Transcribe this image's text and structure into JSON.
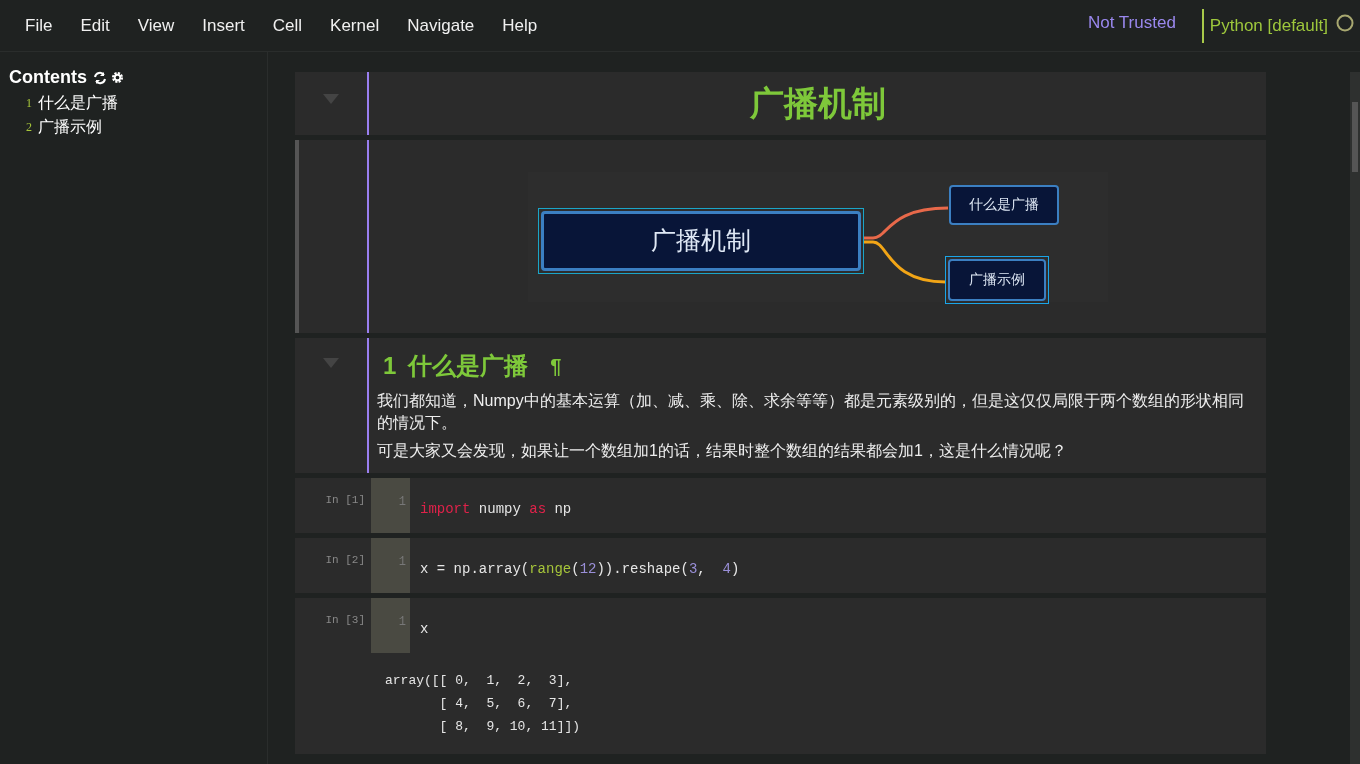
{
  "menu": [
    "File",
    "Edit",
    "View",
    "Insert",
    "Cell",
    "Kernel",
    "Navigate",
    "Help"
  ],
  "trust": "Not Trusted",
  "kernel": "Python [default]",
  "toc": {
    "title": "Contents",
    "items": [
      {
        "number": "1",
        "label": "什么是广播"
      },
      {
        "number": "2",
        "label": "广播示例"
      }
    ]
  },
  "cells": [
    {
      "kind": "title",
      "text": "广播机制"
    },
    {
      "kind": "mindmap",
      "root": "广播机制",
      "branches": [
        {
          "label": "什么是广播",
          "color": "#e8694a"
        },
        {
          "label": "广播示例",
          "color": "#f2a516"
        }
      ]
    },
    {
      "kind": "markdown",
      "heading_number": "1",
      "heading": "什么是广播",
      "anchor": "¶",
      "paragraphs": [
        "我们都知道，Numpy中的基本运算（加、减、乘、除、求余等等）都是元素级别的，但是这仅仅局限于两个数组的形状相同的情况下。",
        "可是大家又会发现，如果让一个数组加1的话，结果时整个数组的结果都会加1，这是什么情况呢？"
      ]
    },
    {
      "kind": "code",
      "prompt": "In [1]",
      "line_number": "1",
      "tokens": [
        {
          "kind": "keyword",
          "text": "import"
        },
        {
          "kind": "plain",
          "text": " numpy "
        },
        {
          "kind": "keyword",
          "text": "as"
        },
        {
          "kind": "plain",
          "text": " np"
        }
      ]
    },
    {
      "kind": "code",
      "prompt": "In [2]",
      "line_number": "1",
      "tokens": [
        {
          "kind": "plain",
          "text": "x = np.array("
        },
        {
          "kind": "builtin",
          "text": "range"
        },
        {
          "kind": "plain",
          "text": "("
        },
        {
          "kind": "number",
          "text": "12"
        },
        {
          "kind": "plain",
          "text": ")).reshape("
        },
        {
          "kind": "number",
          "text": "3"
        },
        {
          "kind": "plain",
          "text": ",  "
        },
        {
          "kind": "number",
          "text": "4"
        },
        {
          "kind": "plain",
          "text": ")"
        }
      ]
    },
    {
      "kind": "code",
      "prompt": "In [3]",
      "line_number": "1",
      "tokens": [
        {
          "kind": "plain",
          "text": "x"
        }
      ],
      "output": [
        "array([[ 0,  1,  2,  3],",
        "       [ 4,  5,  6,  7],",
        "       [ 8,  9, 10, 11]])"
      ]
    }
  ]
}
